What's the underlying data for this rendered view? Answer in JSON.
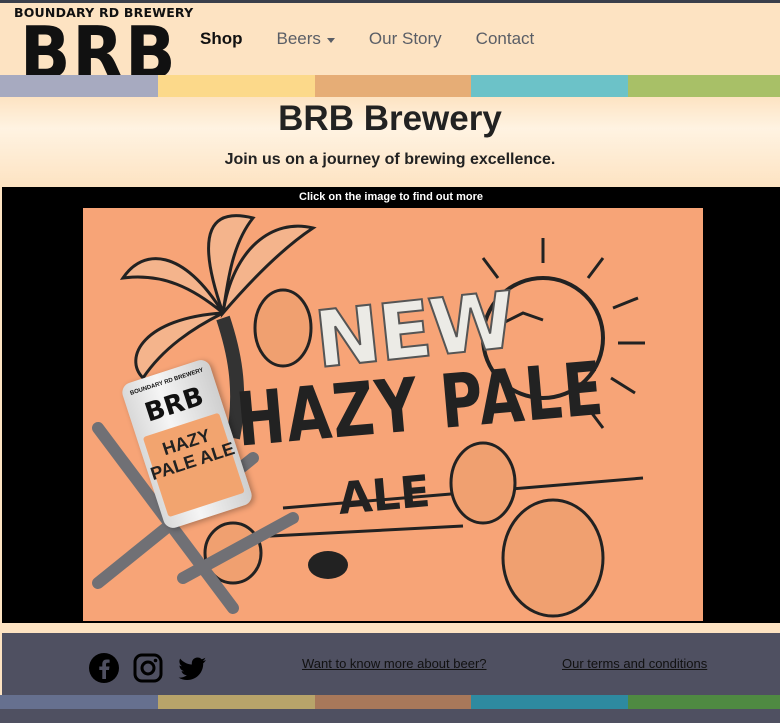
{
  "logo": {
    "small_text": "BOUNDARY RD BREWERY",
    "big_text": "BRB"
  },
  "nav": {
    "items": [
      {
        "label": "Shop"
      },
      {
        "label": "Beers"
      },
      {
        "label": "Our Story"
      },
      {
        "label": "Contact"
      }
    ]
  },
  "hero": {
    "title": "BRB Brewery",
    "subtitle": "Join us on a journey of brewing excellence."
  },
  "feature": {
    "caption": "Click on the image to find out more",
    "promo": {
      "line1": "NEW",
      "line2": "HAZY PALE",
      "line3": "ALE",
      "can_brand": "BRB",
      "can_top": "BOUNDARY RD BREWERY",
      "can_name": "HAZY PALE ALE"
    }
  },
  "footer": {
    "link_beer": "Want to know more about beer?",
    "link_terms": "Our terms and conditions",
    "social": [
      "facebook-icon",
      "instagram-icon",
      "twitter-icon"
    ]
  },
  "colors": {
    "background": "#fde3c2",
    "top_stripes": [
      "#a7aac0",
      "#fcd98a",
      "#e6ad76",
      "#6cc2c8",
      "#a8c067"
    ],
    "bottom_stripes": [
      "#66708f",
      "#b8a46a",
      "#a8785a",
      "#2e8aa0",
      "#4f8a42"
    ],
    "footer": "#4f5061",
    "promo": "#f7a477"
  }
}
